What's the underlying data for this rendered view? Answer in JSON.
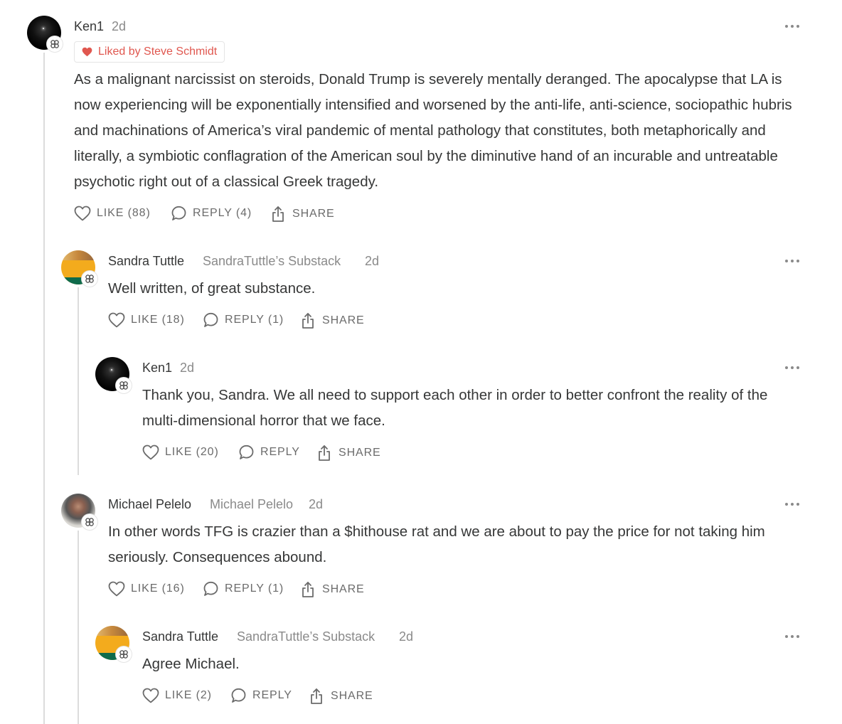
{
  "comments": [
    {
      "author": "Ken1",
      "time": "2d",
      "liked_by": "Liked by Steve Schmidt",
      "body": "As a malignant narcissist on steroids, Donald Trump is severely mentally deranged. The apocalypse that LA is now experiencing will be exponentially intensified and worsened by the anti-life, anti-science, sociopathic hubris and machinations of America’s viral pandemic of mental pathology that constitutes, both metaphorically and literally, a symbiotic conflagration of the American soul by the diminutive hand of an incurable and untreatable psychotic right out of a classical Greek tragedy.",
      "like_label": "LIKE (88)",
      "reply_label": "REPLY (4)",
      "share_label": "SHARE"
    },
    {
      "author": "Sandra Tuttle",
      "publication": "SandraTuttle’s Substack",
      "time": "2d",
      "body": "Well written, of great substance.",
      "like_label": "LIKE (18)",
      "reply_label": "REPLY (1)",
      "share_label": "SHARE"
    },
    {
      "author": "Ken1",
      "time": "2d",
      "body": "Thank you, Sandra. We all need to support each other in order to better confront the reality of the multi-dimensional horror that we face.",
      "like_label": "LIKE (20)",
      "reply_label": "REPLY",
      "share_label": "SHARE"
    },
    {
      "author": "Michael Pelelo",
      "publication": "Michael Pelelo",
      "time": "2d",
      "body": "In other words TFG is crazier than a $hithouse rat and we are about to pay the price for not taking him seriously. Consequences abound.",
      "like_label": "LIKE (16)",
      "reply_label": "REPLY (1)",
      "share_label": "SHARE"
    },
    {
      "author": "Sandra Tuttle",
      "publication": "SandraTuttle’s Substack",
      "time": "2d",
      "body": "Agree Michael.",
      "like_label": "LIKE (2)",
      "reply_label": "REPLY",
      "share_label": "SHARE"
    }
  ],
  "colors": {
    "liked_badge": "#e0574f",
    "text": "#363737",
    "muted": "#8a8a8a",
    "thread_line": "#dcdcdc"
  },
  "icons": [
    "heart-icon",
    "reply-bubble-icon",
    "share-icon",
    "more-options-icon",
    "substack-badge-icon"
  ]
}
